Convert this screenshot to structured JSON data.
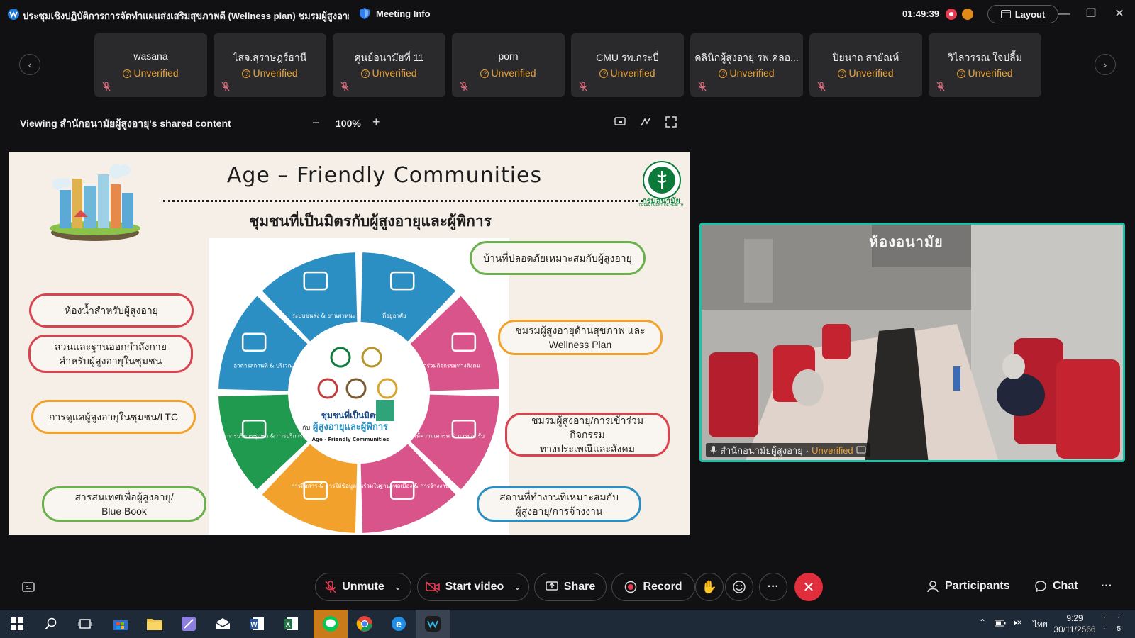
{
  "window": {
    "title": "ประชุมเชิงปฏิบัติการการจัดทำแผนส่งเสริมสุขภาพดี (Wellness plan) ชมรมผู้สูงอายุด้าน...",
    "meeting_info": "Meeting Info",
    "timer": "01:49:39",
    "layout_label": "Layout"
  },
  "participants": [
    {
      "name": "wasana",
      "status": "Unverified"
    },
    {
      "name": "ไสจ.สุราษฎร์ธานี",
      "status": "Unverified"
    },
    {
      "name": "ศูนย์อนามัยที่ 11",
      "status": "Unverified"
    },
    {
      "name": "porn",
      "status": "Unverified"
    },
    {
      "name": "CMU รพ.กระบี่",
      "status": "Unverified"
    },
    {
      "name": "คลินิกผู้สูงอายุ รพ.คลอ...",
      "status": "Unverified"
    },
    {
      "name": "ปิยนาถ สายัณห์",
      "status": "Unverified"
    },
    {
      "name": "วิไลวรรณ ใจปลื้ม",
      "status": "Unverified"
    }
  ],
  "share_bar": {
    "viewing_text": "Viewing สำนักอนามัยผู้สูงอายุ's shared content",
    "zoom_level": "100%"
  },
  "slide": {
    "title": "Age – Friendly Communities",
    "subtitle": "ชุมชนที่เป็นมิตรกับผู้สูงอายุและผู้พิการ",
    "moh_name": "กรมอนามัย",
    "moh_sub": "DEPARTMENT OF HEALTH",
    "center_line1": "ชุมชนที่เป็นมิตร",
    "center_prefix": "กับ",
    "center_line2": "ผู้สูงอายุและผู้พิการ",
    "center_line3": "Age - Friendly Communities",
    "segments": [
      {
        "label": "ระบบขนส่ง & ยานพาหนะ",
        "color": "#2b8fc3"
      },
      {
        "label": "ที่อยู่อาศัย",
        "color": "#2b8fc3"
      },
      {
        "label": "การเข้าร่วมกิจกรรมทางสังคม",
        "color": "#d9548b"
      },
      {
        "label": "การให้ความเคารพ & การยอมรับ",
        "color": "#d9548b"
      },
      {
        "label": "การมีส่วนร่วมในฐานะพลเมือง & การจ้างงาน",
        "color": "#d9548b"
      },
      {
        "label": "การสื่อสาร & การให้ข้อมูล",
        "color": "#f2a22c"
      },
      {
        "label": "การบริการชุมชน & การบริการสุขภาพ",
        "color": "#1f9a4e"
      },
      {
        "label": "อาคารสถานที่ & บริเวณภายนอก",
        "color": "#2b8fc3"
      }
    ],
    "pills": [
      {
        "text": "บ้านที่ปลอดภัยเหมาะสมกับผู้สูงอายุ",
        "color": "#6ab04c"
      },
      {
        "text": "ห้องน้ำสำหรับผู้สูงอายุ",
        "color": "#d9434f"
      },
      {
        "text": "สวนและฐานออกกำลังกาย",
        "text2": "สำหรับผู้สูงอายุในชุมชน",
        "color": "#d9434f"
      },
      {
        "text": "ชมรมผู้สูงอายุด้านสุขภาพ และ",
        "text2": "Wellness Plan",
        "color": "#f2a22c"
      },
      {
        "text": "การดูแลผู้สูงอายุในชุมชน/LTC",
        "color": "#f2a22c"
      },
      {
        "text": "ชมรมผู้สูงอายุ/การเข้าร่วมกิจกรรม",
        "text2": "ทางประเพณีและสังคม",
        "color": "#d9434f"
      },
      {
        "text": "สารสนเทศเพื่อผู้สูงอายุ/",
        "text2": "Blue Book",
        "color": "#6ab04c"
      },
      {
        "text": "สถานที่ทำงานที่เหมาะสมกับ",
        "text2": "ผู้สูงอายุ/การจ้างงาน",
        "color": "#2b8fc3"
      }
    ]
  },
  "video": {
    "name": "สำนักอนามัยผู้สูงอายุ",
    "status": "Unverified",
    "room_sign": "ห้องอนามัย"
  },
  "controls": {
    "unmute": "Unmute",
    "start_video": "Start video",
    "share": "Share",
    "record": "Record",
    "participants": "Participants",
    "chat": "Chat"
  },
  "taskbar": {
    "lang": "ไทย",
    "time": "9:29",
    "date": "30/11/2566",
    "notif_count": "5"
  },
  "colors": {
    "bg": "#111113",
    "tile": "#2a2a2d",
    "unverified": "#e8a336",
    "end_call": "#e02e3c",
    "active_speaker": "#19c3a8"
  }
}
